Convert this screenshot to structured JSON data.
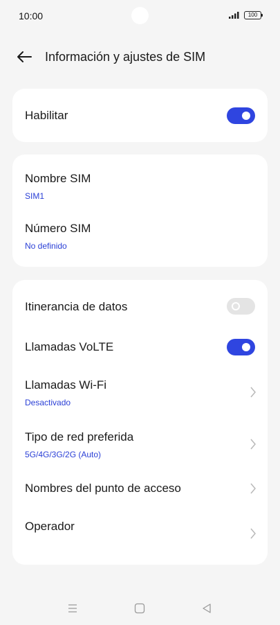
{
  "status_bar": {
    "time": "10:00",
    "battery": "100",
    "icons": [
      "signal-icon",
      "battery-icon"
    ]
  },
  "header": {
    "back_icon": "arrow-left-icon",
    "title": "Información y ajustes de SIM"
  },
  "card_enable": {
    "label": "Habilitar",
    "enabled": true
  },
  "card_sim": {
    "name_label": "Nombre SIM",
    "name_value": "SIM1",
    "number_label": "Número SIM",
    "number_value": "No definido"
  },
  "card_settings": {
    "roaming_label": "Itinerancia de datos",
    "roaming_enabled": false,
    "volte_label": "Llamadas VoLTE",
    "volte_enabled": true,
    "wifi_calls_label": "Llamadas Wi-Fi",
    "wifi_calls_value": "Desactivado",
    "network_type_label": "Tipo de red preferida",
    "network_type_value": "5G/4G/3G/2G (Auto)",
    "apn_label": "Nombres del punto de acceso",
    "operator_label": "Operador"
  },
  "colors": {
    "accent": "#2f45e0",
    "subtext": "#2a3fd6",
    "background": "#f5f5f5",
    "card": "#ffffff",
    "toggle_off": "#e4e4e4"
  },
  "nav_bar": {
    "icons": [
      "menu-icon",
      "home-icon",
      "back-triangle-icon"
    ]
  }
}
